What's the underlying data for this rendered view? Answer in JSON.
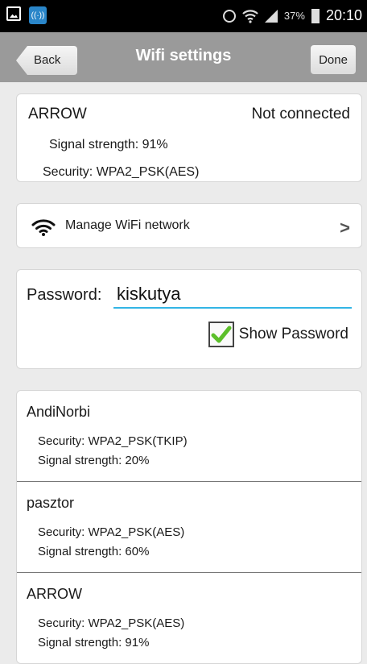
{
  "status_bar": {
    "app_icon": "wifi-app-icon",
    "battery_percent": "37%",
    "time": "20:10"
  },
  "action_bar": {
    "back_label": "Back",
    "title": "Wifi settings",
    "done_label": "Done"
  },
  "connection": {
    "name": "ARROW",
    "status": "Not connected",
    "signal": "Signal strength:  91%",
    "security": "Security:  WPA2_PSK(AES)"
  },
  "manage": {
    "label": "Manage WiFi network"
  },
  "password": {
    "label": "Password:",
    "value": "kiskutya",
    "show_label": "Show Password",
    "show_checked": true
  },
  "networks": [
    {
      "name": "AndiNorbi",
      "security": "Security:  WPA2_PSK(TKIP)",
      "signal": "Signal strength:  20%"
    },
    {
      "name": "pasztor",
      "security": "Security:  WPA2_PSK(AES)",
      "signal": "Signal strength:  60%"
    },
    {
      "name": "ARROW",
      "security": "Security:  WPA2_PSK(AES)",
      "signal": "Signal strength:  91%"
    }
  ],
  "colors": {
    "accent": "#33b5e5",
    "check": "#5cbf2a",
    "action_bar": "#9a9a9a"
  }
}
